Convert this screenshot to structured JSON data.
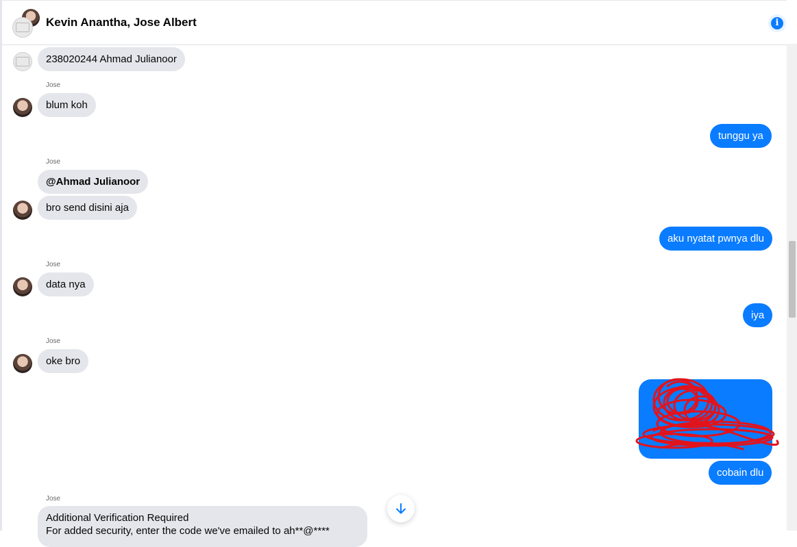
{
  "header": {
    "title": "Kevin Anantha, Jose Albert",
    "info_icon": "info-icon",
    "info_glyph": "i",
    "accent_color": "#0a7cff"
  },
  "messages": {
    "m1": {
      "text": "238020244 Ahmad Julianoor"
    },
    "m2": {
      "sender": "Jose",
      "text": "blum koh"
    },
    "m3": {
      "text": "tunggu ya"
    },
    "m4": {
      "sender": "Jose",
      "mention": "@Ahmad Julianoor",
      "text": "bro send disini aja"
    },
    "m5": {
      "text": "aku nyatat pwnya dlu"
    },
    "m6": {
      "sender": "Jose",
      "text": "data nya"
    },
    "m7": {
      "text": "iya"
    },
    "m8": {
      "sender": "Jose",
      "text": "oke bro"
    },
    "m9": {
      "image": "scribbled-screenshot",
      "text": "cobain dlu"
    },
    "m10": {
      "sender": "Jose",
      "title": "Additional Verification Required",
      "text": "For added security, enter the code we've emailed to ah**@****"
    }
  },
  "scroll_down_icon": "arrow-down-icon"
}
